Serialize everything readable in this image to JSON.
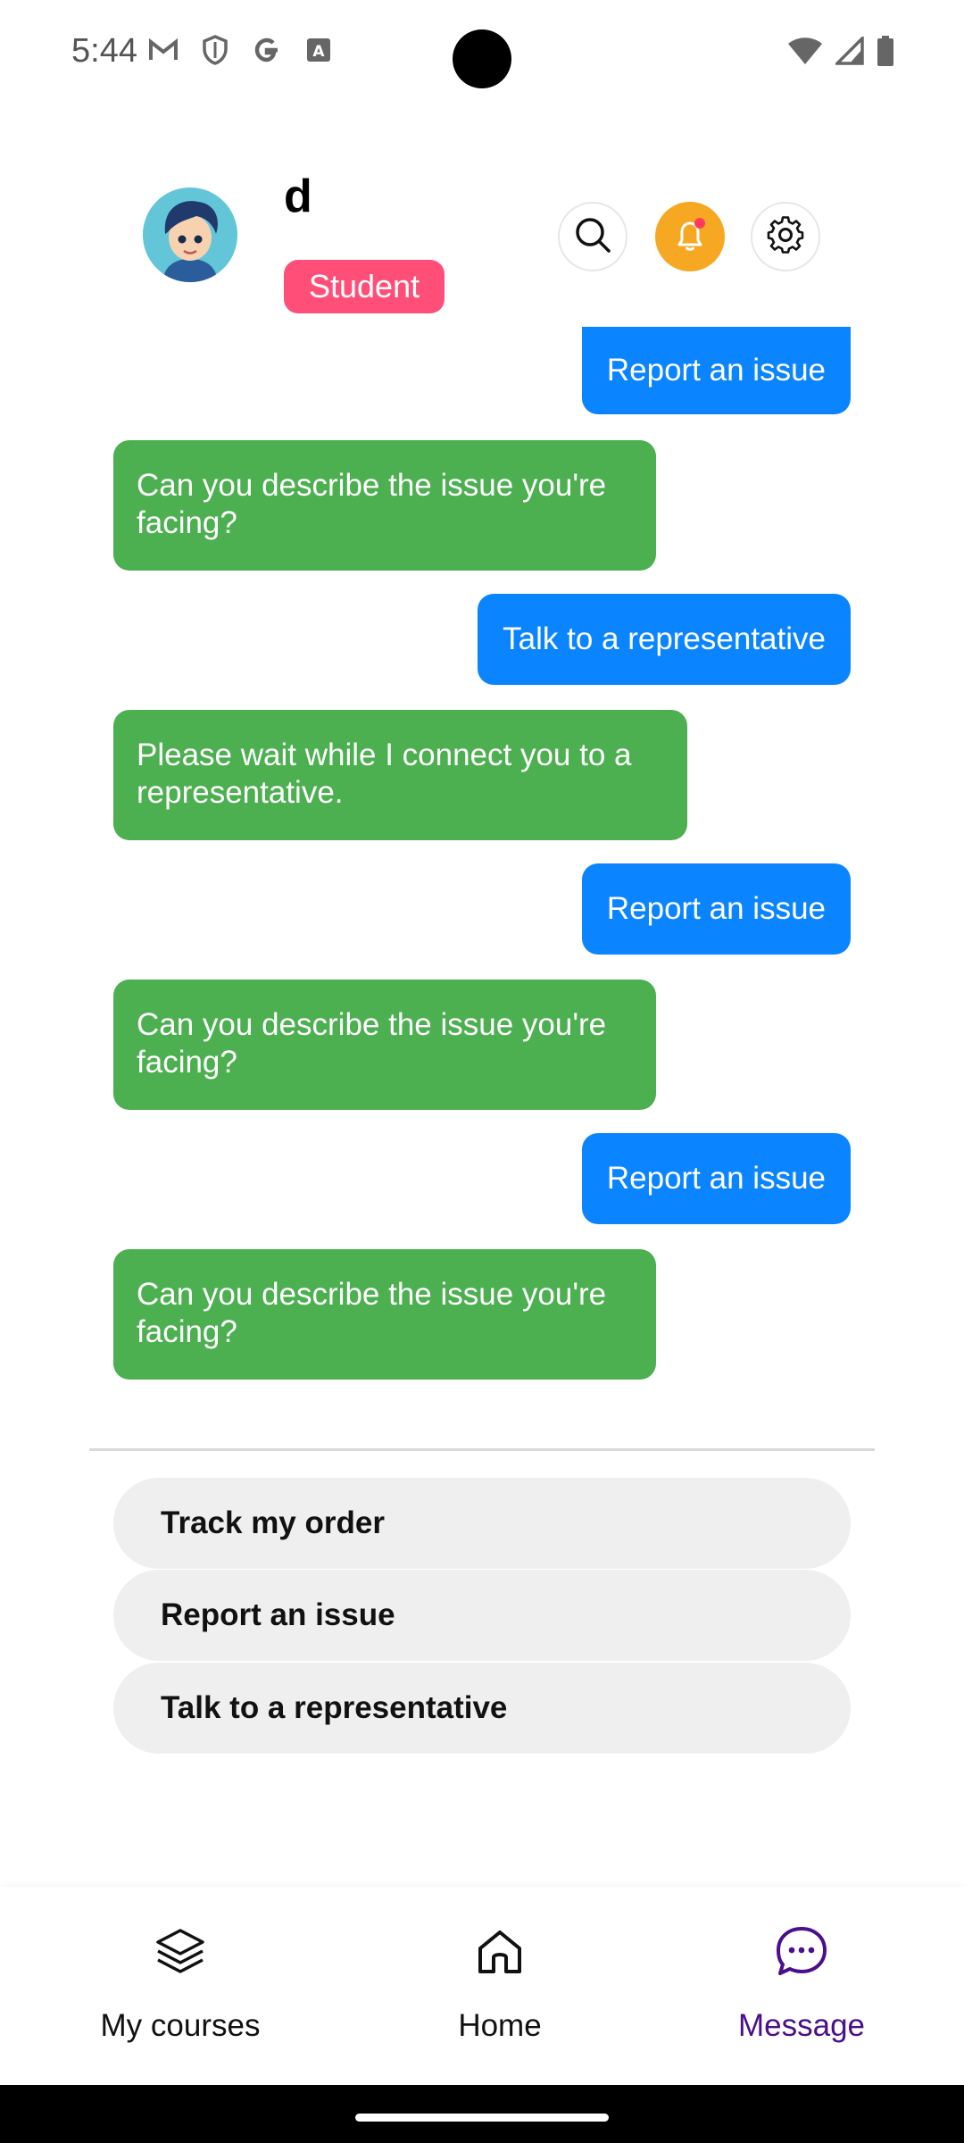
{
  "status_bar": {
    "time": "5:44"
  },
  "header": {
    "user_name": "d",
    "role": "Student"
  },
  "messages": [
    {
      "sender": "user",
      "text": "Report an issue"
    },
    {
      "sender": "bot",
      "text": "Can you describe the issue you're facing?"
    },
    {
      "sender": "user",
      "text": "Talk to a representative"
    },
    {
      "sender": "bot",
      "text": "Please wait while I connect you to a representative."
    },
    {
      "sender": "user",
      "text": "Report an issue"
    },
    {
      "sender": "bot",
      "text": "Can you describe the issue you're facing?"
    },
    {
      "sender": "user",
      "text": "Report an issue"
    },
    {
      "sender": "bot",
      "text": "Can you describe the issue you're facing?"
    }
  ],
  "quick_replies": [
    "Track my order",
    "Report an issue",
    "Talk to a representative"
  ],
  "bottom_nav": [
    {
      "label": "My courses",
      "icon": "layers-icon",
      "active": false
    },
    {
      "label": "Home",
      "icon": "home-icon",
      "active": false
    },
    {
      "label": "Message",
      "icon": "chat-icon",
      "active": true
    }
  ],
  "colors": {
    "user_bubble": "#0a84ff",
    "bot_bubble": "#4caf50",
    "role_badge": "#ff4f79",
    "notification": "#f7a823",
    "active_nav": "#4b0f8a"
  }
}
